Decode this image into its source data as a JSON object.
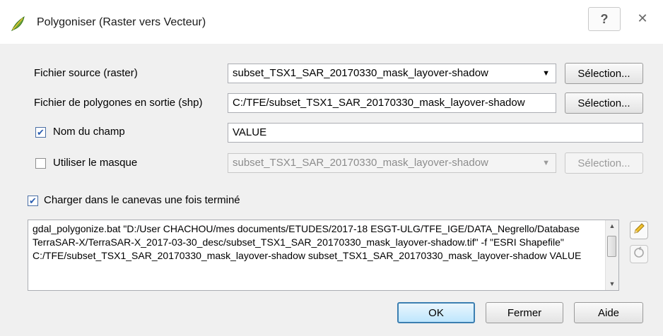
{
  "window": {
    "title": "Polygoniser (Raster vers Vecteur)",
    "help_glyph": "?",
    "close_glyph": "✕"
  },
  "form": {
    "source": {
      "label": "Fichier source (raster)",
      "value": "subset_TSX1_SAR_20170330_mask_layover-shadow",
      "button": "Sélection..."
    },
    "output": {
      "label": "Fichier de polygones en sortie (shp)",
      "value": "C:/TFE/subset_TSX1_SAR_20170330_mask_layover-shadow",
      "button": "Sélection..."
    },
    "field_name": {
      "label": "Nom du champ",
      "checked": true,
      "value": "VALUE"
    },
    "mask": {
      "label": "Utiliser le masque",
      "checked": false,
      "value": "subset_TSX1_SAR_20170330_mask_layover-shadow",
      "button": "Sélection..."
    },
    "load_canvas": {
      "label": "Charger dans le canevas une fois terminé",
      "checked": true
    }
  },
  "command": {
    "text": "gdal_polygonize.bat \"D:/User CHACHOU/mes documents/ETUDES/2017-18 ESGT-ULG/TFE_IGE/DATA_Negrello/Database TerraSAR-X/TerraSAR-X_2017-03-30_desc/subset_TSX1_SAR_20170330_mask_layover-shadow.tif\" -f \"ESRI Shapefile\" C:/TFE/subset_TSX1_SAR_20170330_mask_layover-shadow subset_TSX1_SAR_20170330_mask_layover-shadow VALUE"
  },
  "buttons": {
    "ok": "OK",
    "close": "Fermer",
    "help": "Aide"
  },
  "icons": {
    "app": "qgis-leaf-icon",
    "edit": "pencil-icon",
    "reset": "reset-icon"
  }
}
